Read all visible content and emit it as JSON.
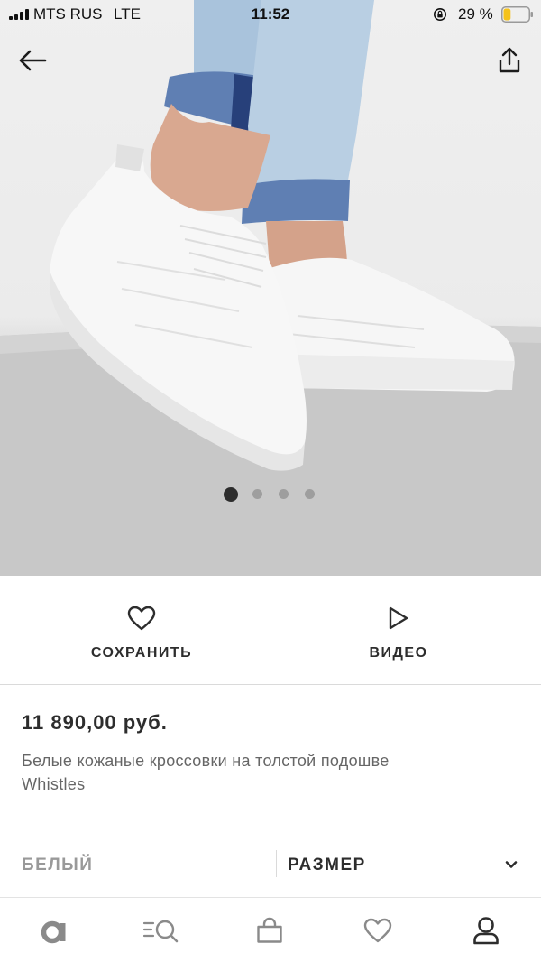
{
  "status_bar": {
    "carrier": "MTS RUS",
    "network": "LTE",
    "time": "11:52",
    "battery_percent": "29 %",
    "battery_level": 0.29,
    "battery_color": "#f5c21b"
  },
  "hero": {
    "gallery_total": 4,
    "gallery_active_index": 0,
    "icons": {
      "back": "arrow-left-icon",
      "share": "share-icon"
    }
  },
  "actions": {
    "save_label": "СОХРАНИТЬ",
    "save_icon": "heart-icon",
    "video_label": "ВИДЕО",
    "video_icon": "play-icon"
  },
  "product": {
    "price": "11 890,00 руб.",
    "title": "Белые кожаные кроссовки на толстой подошве Whistles"
  },
  "variant": {
    "color": "БЕЛЫЙ",
    "size_label": "РАЗМЕР",
    "size_icon": "chevron-down-icon"
  },
  "tabbar": {
    "items": [
      {
        "name": "home",
        "icon": "asos-logo-icon"
      },
      {
        "name": "search",
        "icon": "search-icon"
      },
      {
        "name": "bag",
        "icon": "bag-icon"
      },
      {
        "name": "saved",
        "icon": "heart-icon"
      },
      {
        "name": "account",
        "icon": "user-icon"
      }
    ]
  },
  "colors": {
    "text_primary": "#2d2d2d",
    "text_secondary": "#666666",
    "text_muted": "#999999",
    "divider": "#dadada"
  }
}
